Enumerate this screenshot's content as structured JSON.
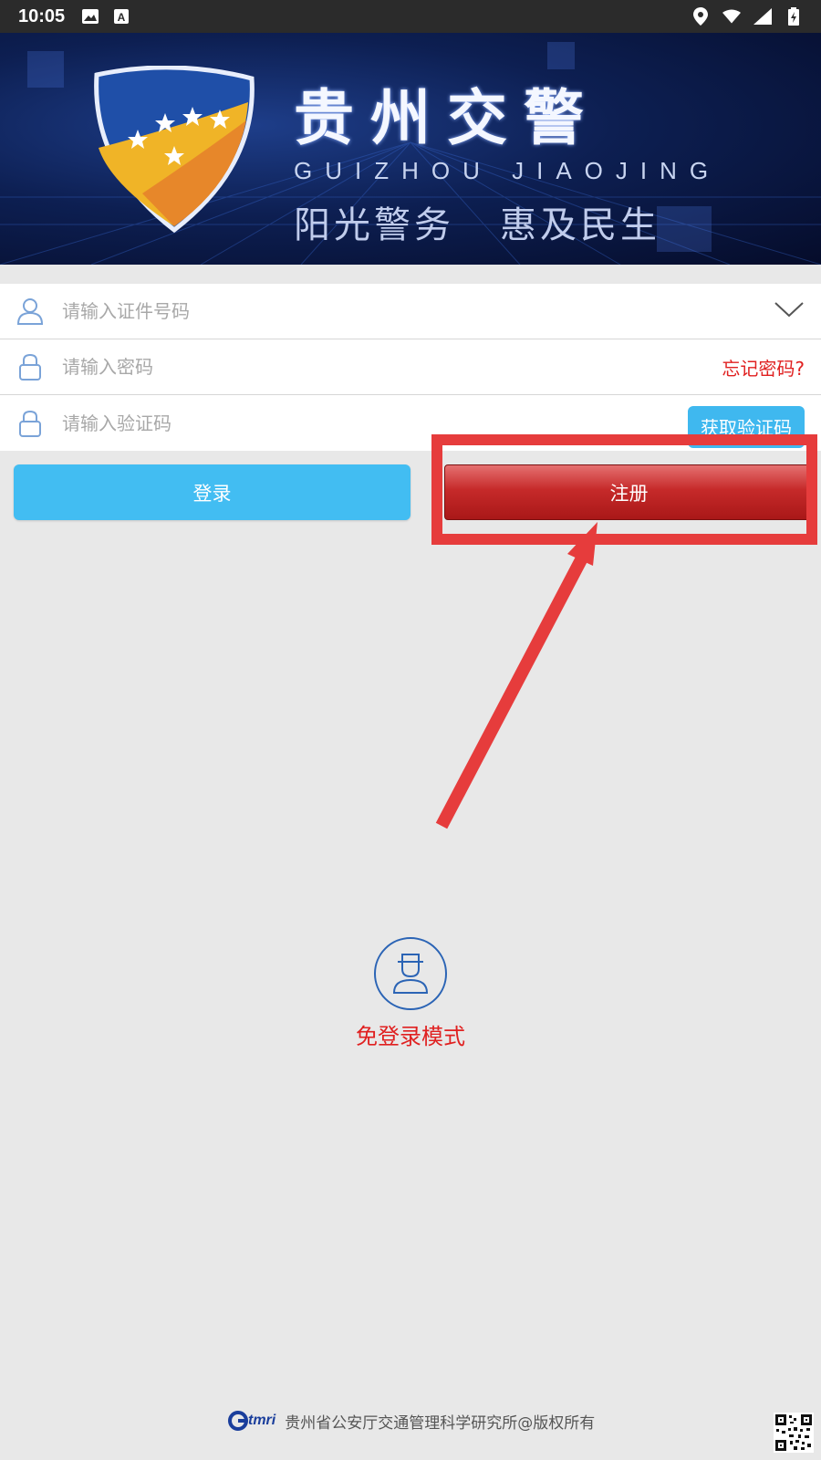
{
  "status_bar": {
    "time": "10:05",
    "icons": [
      "image-icon",
      "font-icon",
      "location-icon",
      "wifi-icon",
      "signal-icon",
      "battery-icon"
    ]
  },
  "banner": {
    "title": "贵州交警",
    "pinyin": "GUIZHOU JIAOJING",
    "slogan_left": "阳光警务",
    "slogan_right": "惠及民生"
  },
  "form": {
    "id_placeholder": "请输入证件号码",
    "password_placeholder": "请输入密码",
    "forgot_password": "忘记密码?",
    "code_placeholder": "请输入验证码",
    "get_code_button": "获取验证码"
  },
  "buttons": {
    "login": "登录",
    "register": "注册"
  },
  "guest": {
    "label": "免登录模式"
  },
  "footer": {
    "logo_text": "tmri",
    "copyright": "贵州省公安厅交通管理科学研究所@版权所有"
  },
  "colors": {
    "accent_blue": "#42bdf2",
    "register_red": "#c62a2a",
    "link_red": "#e02020",
    "annotation_red": "#e63c3c"
  }
}
